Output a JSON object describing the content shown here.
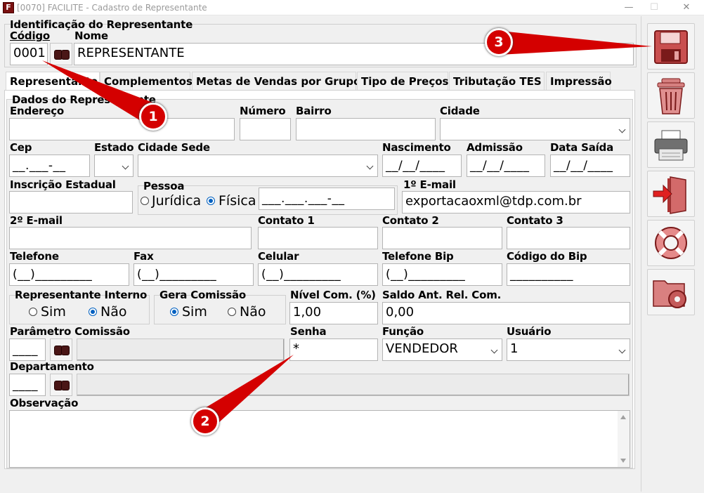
{
  "window": {
    "title": "[0070] FACILITE - Cadastro de Representante",
    "app_icon_glyph": "F",
    "minimize_glyph": "—",
    "maximize_glyph": "☐",
    "close_glyph": "✕"
  },
  "identification": {
    "group_label": "Identificação do Representante",
    "codigo_label": "Código",
    "codigo_value": "0001",
    "nome_label": "Nome",
    "nome_value": "REPRESENTANTE"
  },
  "tabs": [
    {
      "label": "Representante"
    },
    {
      "label": "Complementos"
    },
    {
      "label": "Metas de Vendas por Grupo"
    },
    {
      "label": "Tipo de Preços"
    },
    {
      "label": "Tributação TES"
    },
    {
      "label": "Impressão"
    }
  ],
  "form": {
    "group_label": "Dados do Representante",
    "endereco_label": "Endereço",
    "numero_label": "Número",
    "bairro_label": "Bairro",
    "cidade_label": "Cidade",
    "cep_label": "Cep",
    "cep_value": "__.___-__",
    "estado_label": "Estado",
    "cidade_sede_label": "Cidade Sede",
    "nascimento_label": "Nascimento",
    "nascimento_value": "__/__/____",
    "admissao_label": "Admissão",
    "admissao_value": "__/__/____",
    "data_saida_label": "Data Saída",
    "data_saida_value": "__/__/____",
    "inscricao_label": "Inscrição Estadual",
    "pessoa_label": "Pessoa",
    "pessoa_juridica": "Jurídica",
    "pessoa_fisica": "Física",
    "cpf_value": "___.___.___-__",
    "email1_label": "1º E-mail",
    "email1_value": "exportacaoxml@tdp.com.br",
    "email2_label": "2º E-mail",
    "contato1_label": "Contato 1",
    "contato2_label": "Contato 2",
    "contato3_label": "Contato 3",
    "telefone_label": "Telefone",
    "telefone_value": "(__)_________",
    "fax_label": "Fax",
    "fax_value": "(__)_________",
    "celular_label": "Celular",
    "celular_value": "(__)_________",
    "telefone_bip_label": "Telefone Bip",
    "telefone_bip_value": "(__)_________",
    "codigo_bip_label": "Código do Bip",
    "codigo_bip_value": "__________",
    "rep_interno_label": "Representante Interno",
    "rep_interno_sim": "Sim",
    "rep_interno_nao": "Não",
    "gera_comissao_label": "Gera Comissão",
    "gera_comissao_sim": "Sim",
    "gera_comissao_nao": "Não",
    "nivel_com_label": "Nível Com. (%)",
    "nivel_com_value": "1,00",
    "saldo_label": "Saldo Ant. Rel. Com.",
    "saldo_value": "0,00",
    "parametro_label": "Parâmetro Comissão",
    "parametro_value": "____",
    "senha_label": "Senha",
    "senha_value": "*",
    "funcao_label": "Função",
    "funcao_value": "VENDEDOR",
    "usuario_label": "Usuário",
    "usuario_value": "1",
    "departamento_label": "Departamento",
    "departamento_value": "____",
    "observacao_label": "Observação"
  },
  "callouts": [
    {
      "number": "1"
    },
    {
      "number": "2"
    },
    {
      "number": "3"
    }
  ],
  "colors": {
    "callout": "#d40000",
    "accent": "#0060c0"
  }
}
